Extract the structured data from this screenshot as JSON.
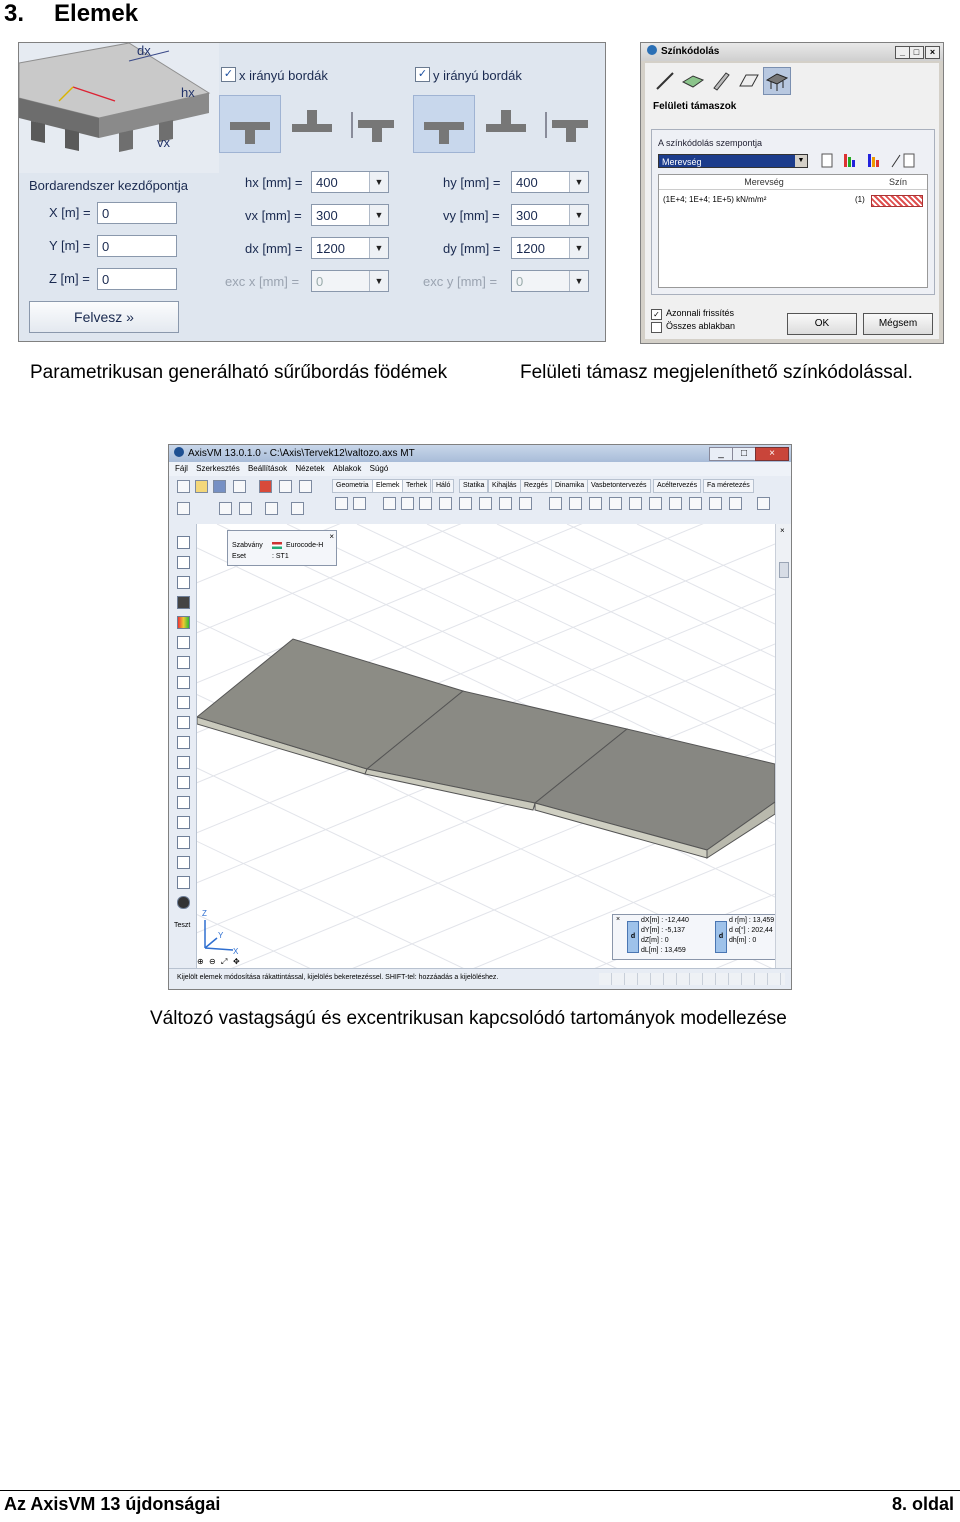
{
  "heading": {
    "number": "3.",
    "title": "Elemek"
  },
  "figure1": {
    "x_ribs_label": "x irányú bordák",
    "y_ribs_label": "y irányú bordák",
    "origin_label": "Bordarendszer kezdőpontja",
    "origin_fields": [
      {
        "label": "X [m] =",
        "value": "0"
      },
      {
        "label": "Y [m] =",
        "value": "0"
      },
      {
        "label": "Z [m] =",
        "value": "0"
      }
    ],
    "x_fields": [
      {
        "label": "hx [mm] =",
        "value": "400"
      },
      {
        "label": "vx [mm] =",
        "value": "300"
      },
      {
        "label": "dx [mm] =",
        "value": "1200"
      },
      {
        "label": "exc x [mm] =",
        "value": "0"
      }
    ],
    "y_fields": [
      {
        "label": "hy [mm] =",
        "value": "400"
      },
      {
        "label": "vy [mm] =",
        "value": "300"
      },
      {
        "label": "dy [mm] =",
        "value": "1200"
      },
      {
        "label": "exc y [mm] =",
        "value": "0"
      }
    ],
    "button": "Felvesz »",
    "diagram_labels": {
      "dx": "dx",
      "hx": "hx",
      "vx": "vx"
    }
  },
  "caption1": "Parametrikusan generálható sűrűbordás födémek",
  "figure2": {
    "title": "Színkódolás",
    "section": "Felületi támaszok",
    "criterion_label": "A színkódolás szempontja",
    "criterion_value": "Merevség",
    "col_stiffness": "Merevség",
    "col_color": "Szín",
    "row_value": "(1E+4; 1E+4; 1E+5) kN/m/m²",
    "row_index": "(1)",
    "check_immediate": "Azonnali frissítés",
    "check_all": "Összes ablakban",
    "ok": "OK",
    "cancel": "Mégsem"
  },
  "caption2": "Felületi támasz megjeleníthető színkódolással.",
  "figure3": {
    "title": "AxisVM 13.0.1.0 - C:\\Axis\\Tervek12\\valtozo.axs MT",
    "menu": [
      "Fájl",
      "Szerkesztés",
      "Beállítások",
      "Nézetek",
      "Ablakok",
      "Súgó"
    ],
    "tabs": [
      "Geometria",
      "Elemek",
      "Terhek",
      "Háló",
      "Statika",
      "Kihajlás",
      "Rezgés",
      "Dinamika",
      "Vasbetontervezés",
      "Acéltervezés",
      "Fa méretezés"
    ],
    "info_standard_label": "Szabvány",
    "info_standard_value": "Eurocode-H",
    "info_case_label": "Eset",
    "info_case_value": ": ST1",
    "teszt": "Teszt",
    "axis_z": "Z",
    "axis_y": "Y",
    "axis_x": "X",
    "coord_left": [
      "dX[m] : -12,440",
      "dY[m] : -5,137",
      "dZ[m] : 0",
      "dL[m] : 13,459"
    ],
    "coord_right": [
      "d r[m] : 13,459",
      "d α[°] : 202,44",
      "dh[m] : 0"
    ],
    "status": "Kijelölt elemek módosítása rákattintással, kijelölés bekeretezéssel. SHIFT-tel: hozzáadás a kijelöléshez."
  },
  "caption3": "Változó vastagságú és excentrikusan kapcsolódó tartományok modellezése",
  "footer": {
    "left": "Az AxisVM 13 újdonságai",
    "right": "8. oldal"
  }
}
